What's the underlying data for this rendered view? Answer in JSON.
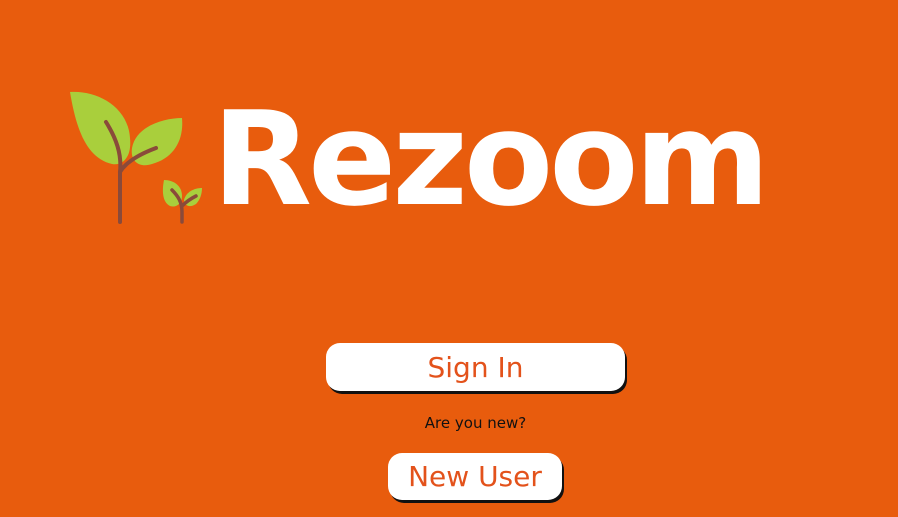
{
  "brand": {
    "name": "Rezoom",
    "logo_icon": "sprout-icon",
    "colors": {
      "background": "#e85c0d",
      "leaf": "#a9cf3c",
      "stem": "#8a4a3a",
      "text": "#ffffff"
    }
  },
  "auth": {
    "sign_in_label": "Sign In",
    "new_prompt": "Are you new?",
    "new_user_label": "New User",
    "button_text_color": "#e3521b"
  }
}
